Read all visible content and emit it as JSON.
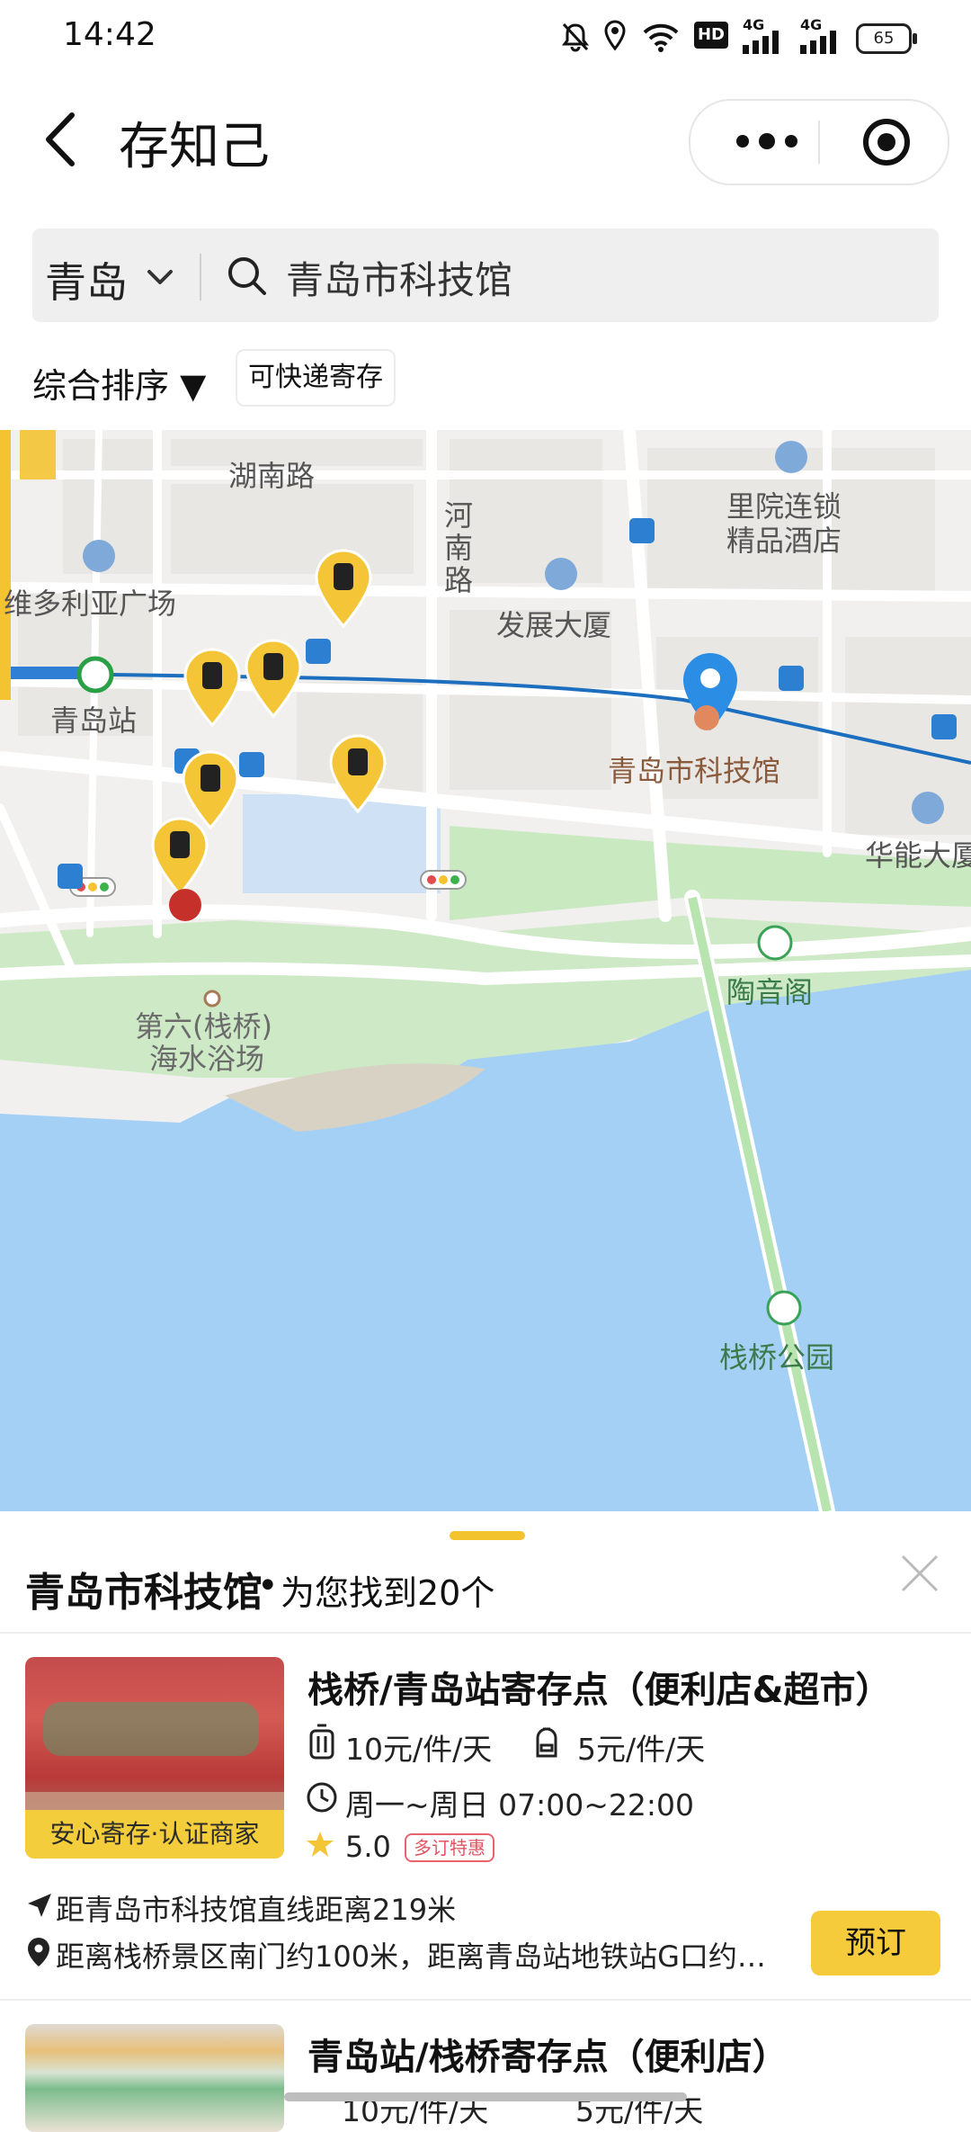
{
  "status_bar": {
    "time": "14:42",
    "battery": "65",
    "network1": "4G",
    "network2": "4G",
    "hd": "HD"
  },
  "header": {
    "title": "存知己",
    "back_label": "返回"
  },
  "search": {
    "city": "青岛",
    "query": "青岛市科技馆"
  },
  "filters": {
    "sort_label": "综合排序 ▼",
    "express_label": "可快递寄存"
  },
  "map": {
    "roads": [
      "湖南路",
      "河南路"
    ],
    "places": [
      "里院连锁精品酒店",
      "维多利亚广场",
      "发展大厦",
      "青岛站",
      "青岛市科技馆",
      "华能大厦",
      "陶音阁",
      "第六(栈桥)海水浴场",
      "栈桥公园"
    ],
    "place_lines": {
      "hotel": [
        "里院连锁",
        "精品酒店"
      ],
      "huaneng": "华能大厦",
      "beach": [
        "第六(栈桥)",
        "海水浴场"
      ],
      "henan": [
        "河",
        "南",
        "路"
      ]
    },
    "colors": {
      "land": "#f1f0ee",
      "water": "#a4d0f6",
      "park": "#c9e9c0",
      "road": "#ffffff",
      "metro": "#1c6fbf",
      "pin": "#f4c637",
      "location": "#2b8de3"
    }
  },
  "sheet": {
    "title": "青岛市科技馆",
    "count_text": "为您找到20个"
  },
  "stores": [
    {
      "title": "栈桥/青岛站寄存点（便利店&超市）",
      "badge": "安心寄存·认证商家",
      "price_luggage": "10元/件/天",
      "price_bag": "5元/件/天",
      "hours": "周一~周日 07:00~22:00",
      "rating": "5.0",
      "promo": "多订特惠",
      "distance": "距青岛市科技馆直线距离219米",
      "address": "距离栈桥景区南门约100米，距离青岛站地铁站G口约…",
      "book_label": "预订"
    },
    {
      "title": "青岛站/栈桥寄存点（便利店）",
      "price_luggage": "10元/件/天",
      "price_bag": "5元/件/天"
    }
  ]
}
